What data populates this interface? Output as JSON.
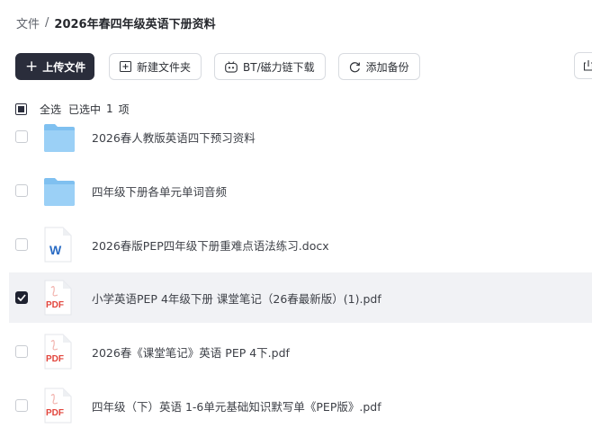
{
  "breadcrumb": {
    "root": "文件",
    "separator": "/",
    "current": "2026年春四年级英语下册资料"
  },
  "toolbar": {
    "upload_label": "上传文件",
    "new_folder_label": "新建文件夹",
    "bt_label": "BT/磁力链下载",
    "backup_label": "添加备份"
  },
  "selection": {
    "select_all": "全选",
    "selected_prefix": "已选中",
    "selected_count": "1",
    "selected_suffix": "项"
  },
  "files": [
    {
      "name": "2026春人教版英语四下预习资料",
      "type": "folder",
      "checked": false
    },
    {
      "name": "四年级下册各单元单词音频",
      "type": "folder",
      "checked": false
    },
    {
      "name": "2026春版PEP四年级下册重难点语法练习.docx",
      "type": "docx",
      "checked": false
    },
    {
      "name": "小学英语PEP 4年级下册 课堂笔记（26春最新版）(1).pdf",
      "type": "pdf",
      "checked": true
    },
    {
      "name": "2026春《课堂笔记》英语 PEP 4下.pdf",
      "type": "pdf",
      "checked": false
    },
    {
      "name": "四年级（下）英语 1-6单元基础知识默写单《PEP版》.pdf",
      "type": "pdf",
      "checked": false
    }
  ],
  "icons": {
    "folder_icon": "folder-icon",
    "word_icon": "word-doc-icon",
    "pdf_icon": "pdf-icon",
    "word_badge": "W",
    "pdf_badge": "PDF"
  },
  "colors": {
    "primary": "#2a2d3b",
    "folder": "#7fc0f0",
    "word_blue": "#2b6cc4",
    "pdf_red": "#e2453c",
    "selected_row": "#f1f2f5"
  }
}
